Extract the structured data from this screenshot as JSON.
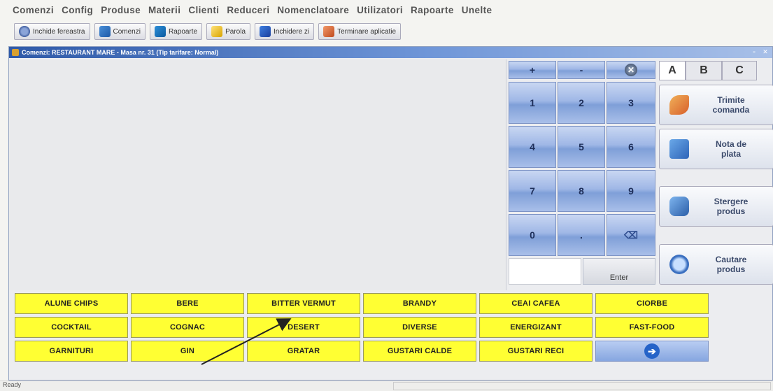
{
  "menu": [
    "Comenzi",
    "Config",
    "Produse",
    "Materii",
    "Clienti",
    "Reduceri",
    "Nomenclatoare",
    "Utilizatori",
    "Rapoarte",
    "Unelte"
  ],
  "toolbar": {
    "close_window": "Inchide fereastra",
    "orders": "Comenzi",
    "reports": "Rapoarte",
    "password": "Parola",
    "close_day": "Inchidere zi",
    "exit_app": "Terminare aplicatie"
  },
  "window": {
    "title": "Comenzi: RESTAURANT MARE - Masa nr. 31 (Tip tarifare: Normal)"
  },
  "keypad": {
    "plus": "+",
    "minus": "-",
    "keys": [
      "1",
      "2",
      "3",
      "4",
      "5",
      "6",
      "7",
      "8",
      "9",
      "0",
      "."
    ],
    "enter": "Enter"
  },
  "tabs": [
    "A",
    "B",
    "C"
  ],
  "actions": {
    "send": "Trimite\ncomanda",
    "bill": "Nota de\nplata",
    "delete": "Stergere\nprodus",
    "search": "Cautare\nprodus"
  },
  "categories": [
    "ALUNE CHIPS",
    "BERE",
    "BITTER VERMUT",
    "BRANDY",
    "CEAI CAFEA",
    "CIORBE",
    "COCKTAIL",
    "COGNAC",
    "DESERT",
    "DIVERSE",
    "ENERGIZANT",
    "FAST-FOOD",
    "GARNITURI",
    "GIN",
    "GRATAR",
    "GUSTARI CALDE",
    "GUSTARI RECI"
  ],
  "status": {
    "text": "Ready"
  },
  "colors": {
    "category_bg": "#ffff33",
    "keypad_blue": "#9fb7e6",
    "title_bar": "#2f5aa8"
  }
}
